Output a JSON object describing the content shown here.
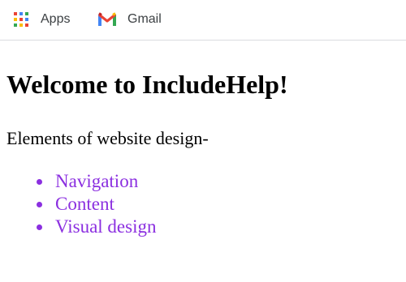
{
  "bookmarks_bar": {
    "items": [
      {
        "label": "Apps",
        "icon": "apps-grid-icon"
      },
      {
        "label": "Gmail",
        "icon": "gmail-icon"
      }
    ]
  },
  "page": {
    "heading": "Welcome to IncludeHelp!",
    "intro": "Elements of website design-",
    "list_items": [
      "Navigation",
      "Content",
      "Visual design"
    ]
  },
  "colors": {
    "link": "#8b2fe0",
    "toolbar_text": "#3c4043",
    "divider": "#dadce0"
  }
}
